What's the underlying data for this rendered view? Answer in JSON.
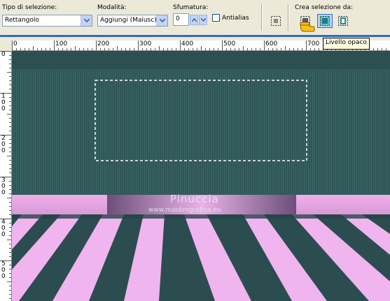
{
  "toolbar": {
    "selection_type": {
      "label": "Tipo di selezione:",
      "value": "Rettangolo"
    },
    "mode": {
      "label": "Modalità:",
      "value": "Aggiungi (Maiusc)"
    },
    "feather": {
      "label": "Sfumatura:",
      "value": "0"
    },
    "antialias": {
      "label": "Antialias",
      "checked": false
    },
    "create_from": {
      "label": "Crea selezione da:"
    },
    "tooltip": "Livello opaco"
  },
  "ruler": {
    "horizontal_labels": [
      "0",
      "100",
      "200",
      "300",
      "400",
      "500",
      "600",
      "700"
    ],
    "vertical_labels": [
      "0",
      "1 0 0",
      "2 0 0",
      "3 0 0",
      "4 0 0",
      "5 0 0"
    ]
  },
  "canvas": {
    "watermark_title": "Pinuccia",
    "watermark_url": "www.maidiregrafica.eu"
  },
  "colors": {
    "teal_wall": "#2f5555",
    "pink": "#f0b0ee",
    "dark_floor": "#2b4d4f",
    "accent_blue": "#316ac5"
  },
  "icons": [
    "dropdown-arrow-icon",
    "spin-up-icon",
    "spin-down-icon",
    "select-none-icon",
    "select-from-mask-icon",
    "select-opaque-layer-icon",
    "select-from-vector-icon",
    "pointing-hand-icon"
  ]
}
